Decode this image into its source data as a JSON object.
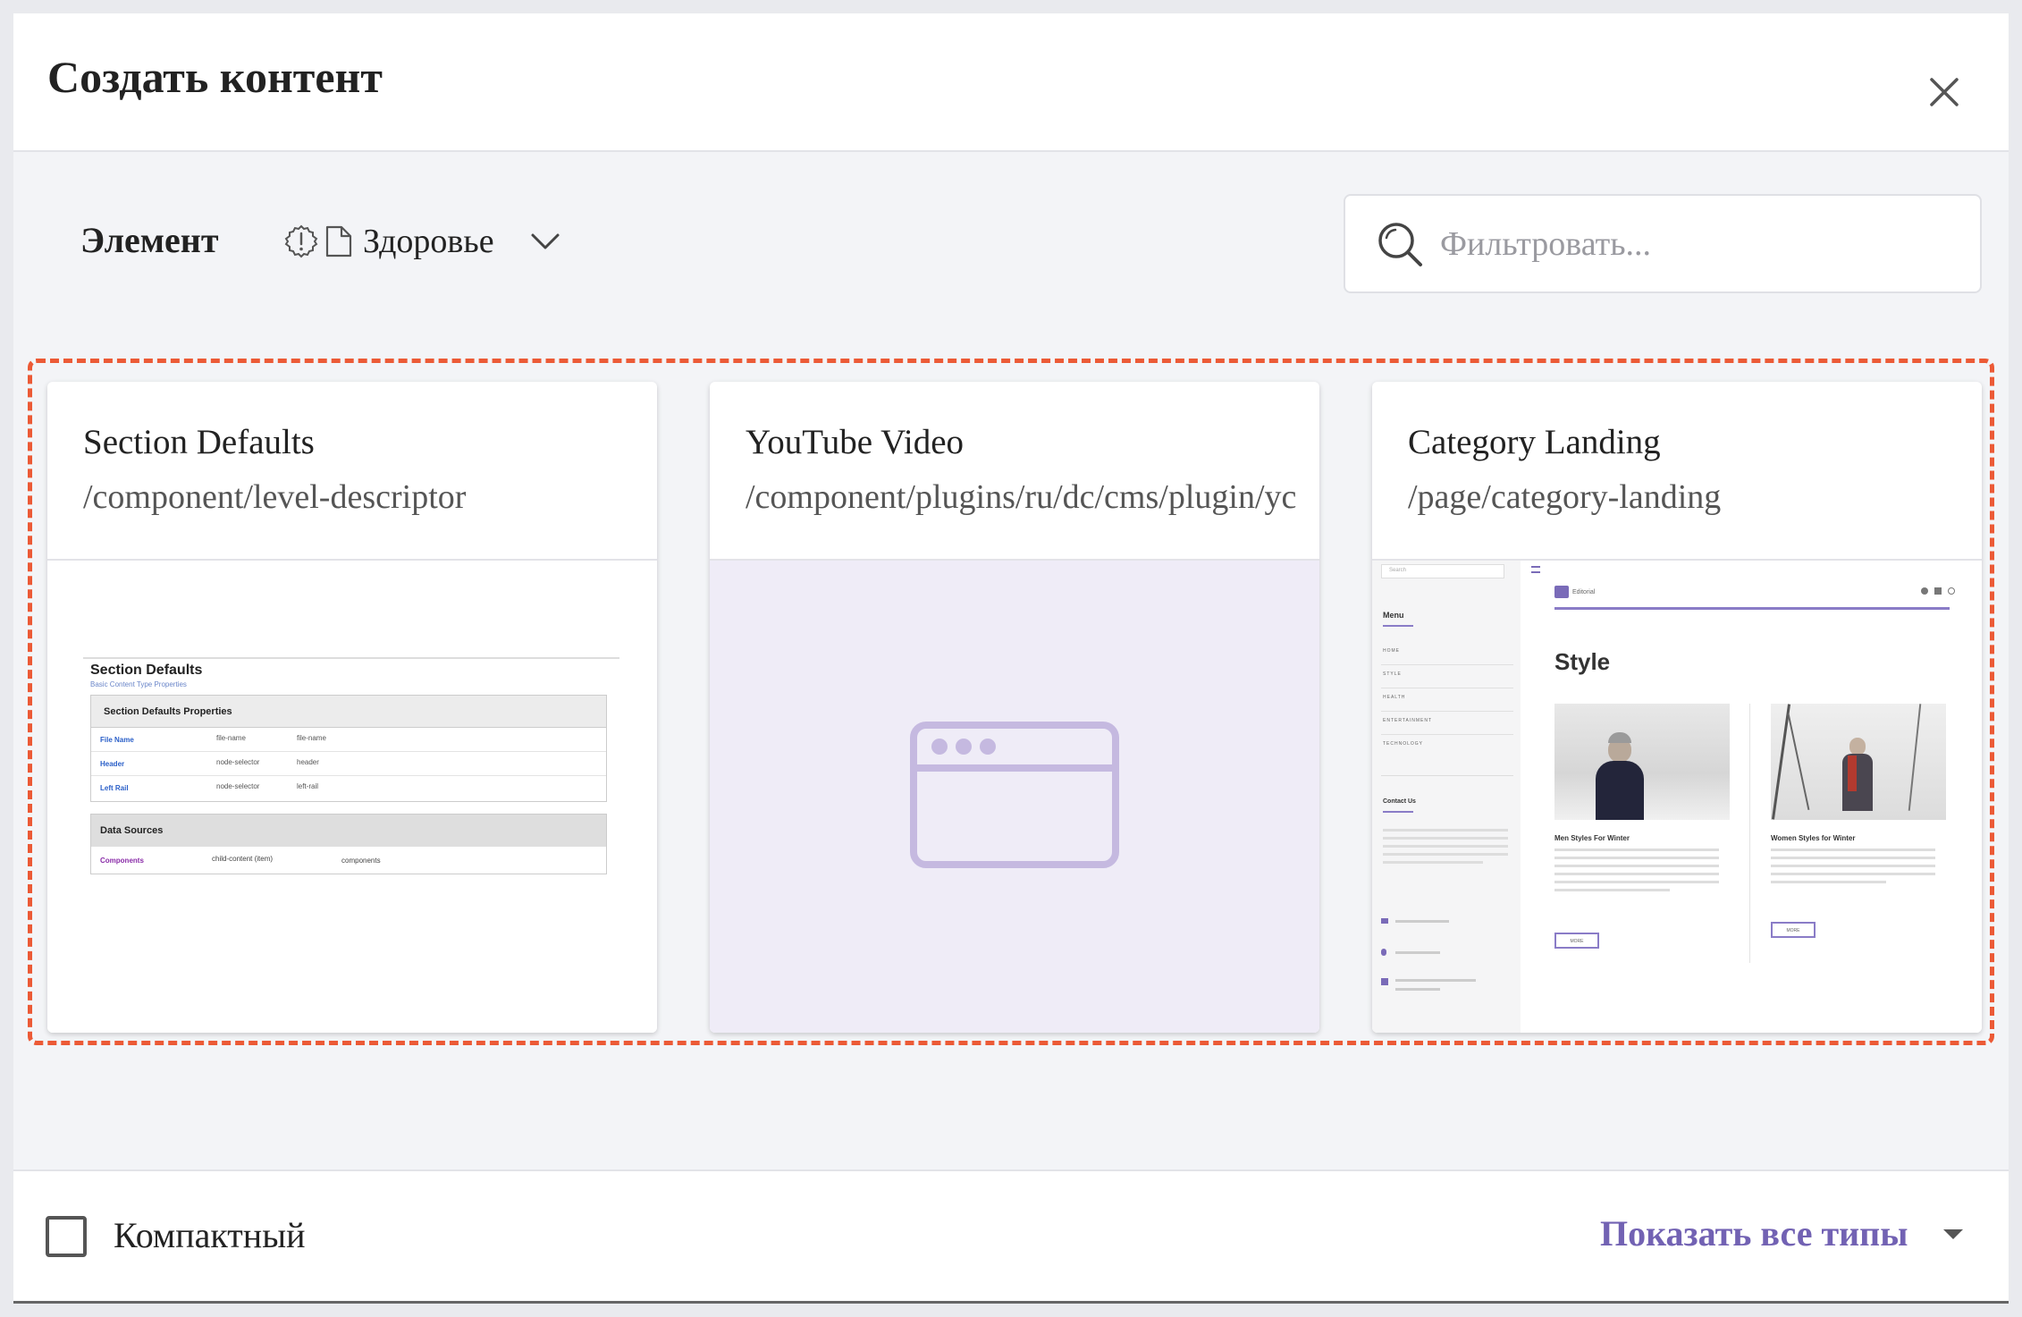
{
  "dialog": {
    "title": "Создать контент"
  },
  "toolbar": {
    "label": "Элемент",
    "breadcrumb": "Здоровье",
    "search_placeholder": "Фильтровать..."
  },
  "cards": [
    {
      "title": "Section Defaults",
      "path": "/component/level-descriptor",
      "preview": {
        "heading": "Section Defaults",
        "subheading": "Basic Content Type Properties",
        "properties_title": "Section Defaults Properties",
        "rows": [
          [
            "File Name",
            "file-name",
            "file-name"
          ],
          [
            "Header",
            "node-selector",
            "header"
          ],
          [
            "Left Rail",
            "node-selector",
            "left-rail"
          ]
        ],
        "sources_title": "Data Sources",
        "sources_row": [
          "Components",
          "child-content (item)",
          "components"
        ]
      }
    },
    {
      "title": "YouTube Video",
      "path": "/component/plugins/ru/dc/cms/plugin/yc"
    },
    {
      "title": "Category Landing",
      "path": "/page/category-landing",
      "preview": {
        "search": "Search",
        "menu_title": "Menu",
        "menu_items": [
          "HOME",
          "STYLE",
          "HEALTH",
          "ENTERTAINMENT",
          "TECHNOLOGY"
        ],
        "contact_title": "Contact Us",
        "brand": "Editorial",
        "style_heading": "Style",
        "article1_title": "Men Styles For Winter",
        "article2_title": "Women Styles for Winter",
        "more": "MORE"
      }
    }
  ],
  "footer": {
    "compact_label": "Компактный",
    "show_all_label": "Показать все типы"
  },
  "colors": {
    "accent": "#7262b3",
    "outline": "#ec5a36",
    "placeholder_bg": "#efecf7",
    "placeholder_icon": "#c5b9e0"
  }
}
